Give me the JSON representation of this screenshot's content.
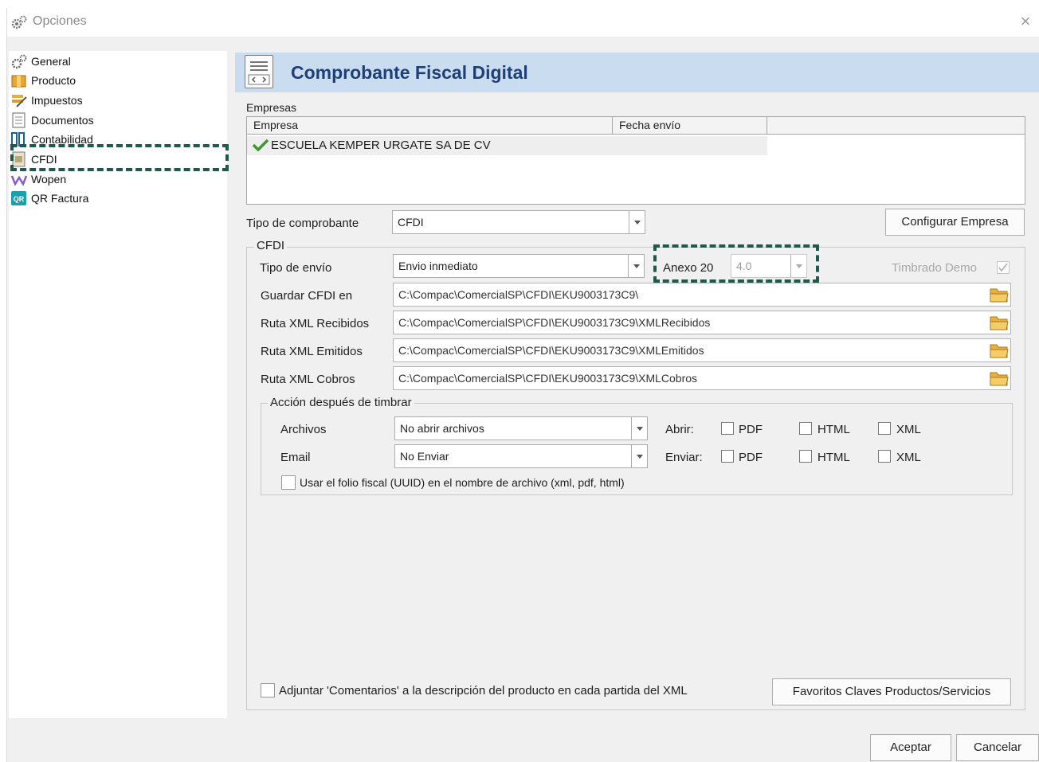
{
  "window": {
    "title": "Opciones",
    "close_glyph": "×"
  },
  "sidebar": {
    "items": [
      {
        "label": "General",
        "icon": "gears-icon"
      },
      {
        "label": "Producto",
        "icon": "box-icon"
      },
      {
        "label": "Impuestos",
        "icon": "tax-icon"
      },
      {
        "label": "Documentos",
        "icon": "document-icon"
      },
      {
        "label": "Contabilidad",
        "icon": "ledger-icon"
      },
      {
        "label": "CFDI",
        "icon": "cfdi-icon",
        "selected": true
      },
      {
        "label": "Wopen",
        "icon": "wopen-icon"
      },
      {
        "label": "QR Factura",
        "icon": "qr-icon"
      }
    ]
  },
  "header": {
    "title": "Comprobante Fiscal Digital"
  },
  "empresas": {
    "section_label": "Empresas",
    "columns": [
      "Empresa",
      "Fecha envío"
    ],
    "rows": [
      {
        "empresa": "ESCUELA KEMPER URGATE SA DE CV",
        "fecha": ""
      }
    ]
  },
  "tipo_comprobante": {
    "label": "Tipo de comprobante",
    "value": "CFDI"
  },
  "configurar_button": "Configurar Empresa",
  "cfdi_group": {
    "title": "CFDI",
    "tipo_envio": {
      "label": "Tipo de envío",
      "value": "Envio inmediato"
    },
    "anexo": {
      "label": "Anexo 20",
      "value": "4.0"
    },
    "timbrado_demo": {
      "label": "Timbrado Demo",
      "checked": true
    },
    "paths": [
      {
        "label": "Guardar CFDI en",
        "value": "C:\\Compac\\ComercialSP\\CFDI\\EKU9003173C9\\"
      },
      {
        "label": "Ruta XML Recibidos",
        "value": "C:\\Compac\\ComercialSP\\CFDI\\EKU9003173C9\\XMLRecibidos"
      },
      {
        "label": "Ruta XML Emitidos",
        "value": "C:\\Compac\\ComercialSP\\CFDI\\EKU9003173C9\\XMLEmitidos"
      },
      {
        "label": "Ruta XML Cobros",
        "value": "C:\\Compac\\ComercialSP\\CFDI\\EKU9003173C9\\XMLCobros"
      }
    ]
  },
  "accion": {
    "title": "Acción después de timbrar",
    "archivos": {
      "label": "Archivos",
      "value": "No abrir archivos",
      "action_label": "Abrir:"
    },
    "email": {
      "label": "Email",
      "value": "No Enviar",
      "action_label": "Enviar:"
    },
    "formats": [
      "PDF",
      "HTML",
      "XML"
    ],
    "uuid_label": "Usar el folio fiscal (UUID) en el nombre de archivo (xml, pdf, html)"
  },
  "comentarios_label": "Adjuntar 'Comentarios' a la descripción del producto en cada partida del XML",
  "favoritos_button": "Favoritos Claves Productos/Servicios",
  "footer": {
    "accept": "Aceptar",
    "cancel": "Cancelar"
  },
  "colors": {
    "header_bg": "#c9dcf0",
    "header_title": "#1f3f77",
    "highlight": "#1d5a4c"
  }
}
